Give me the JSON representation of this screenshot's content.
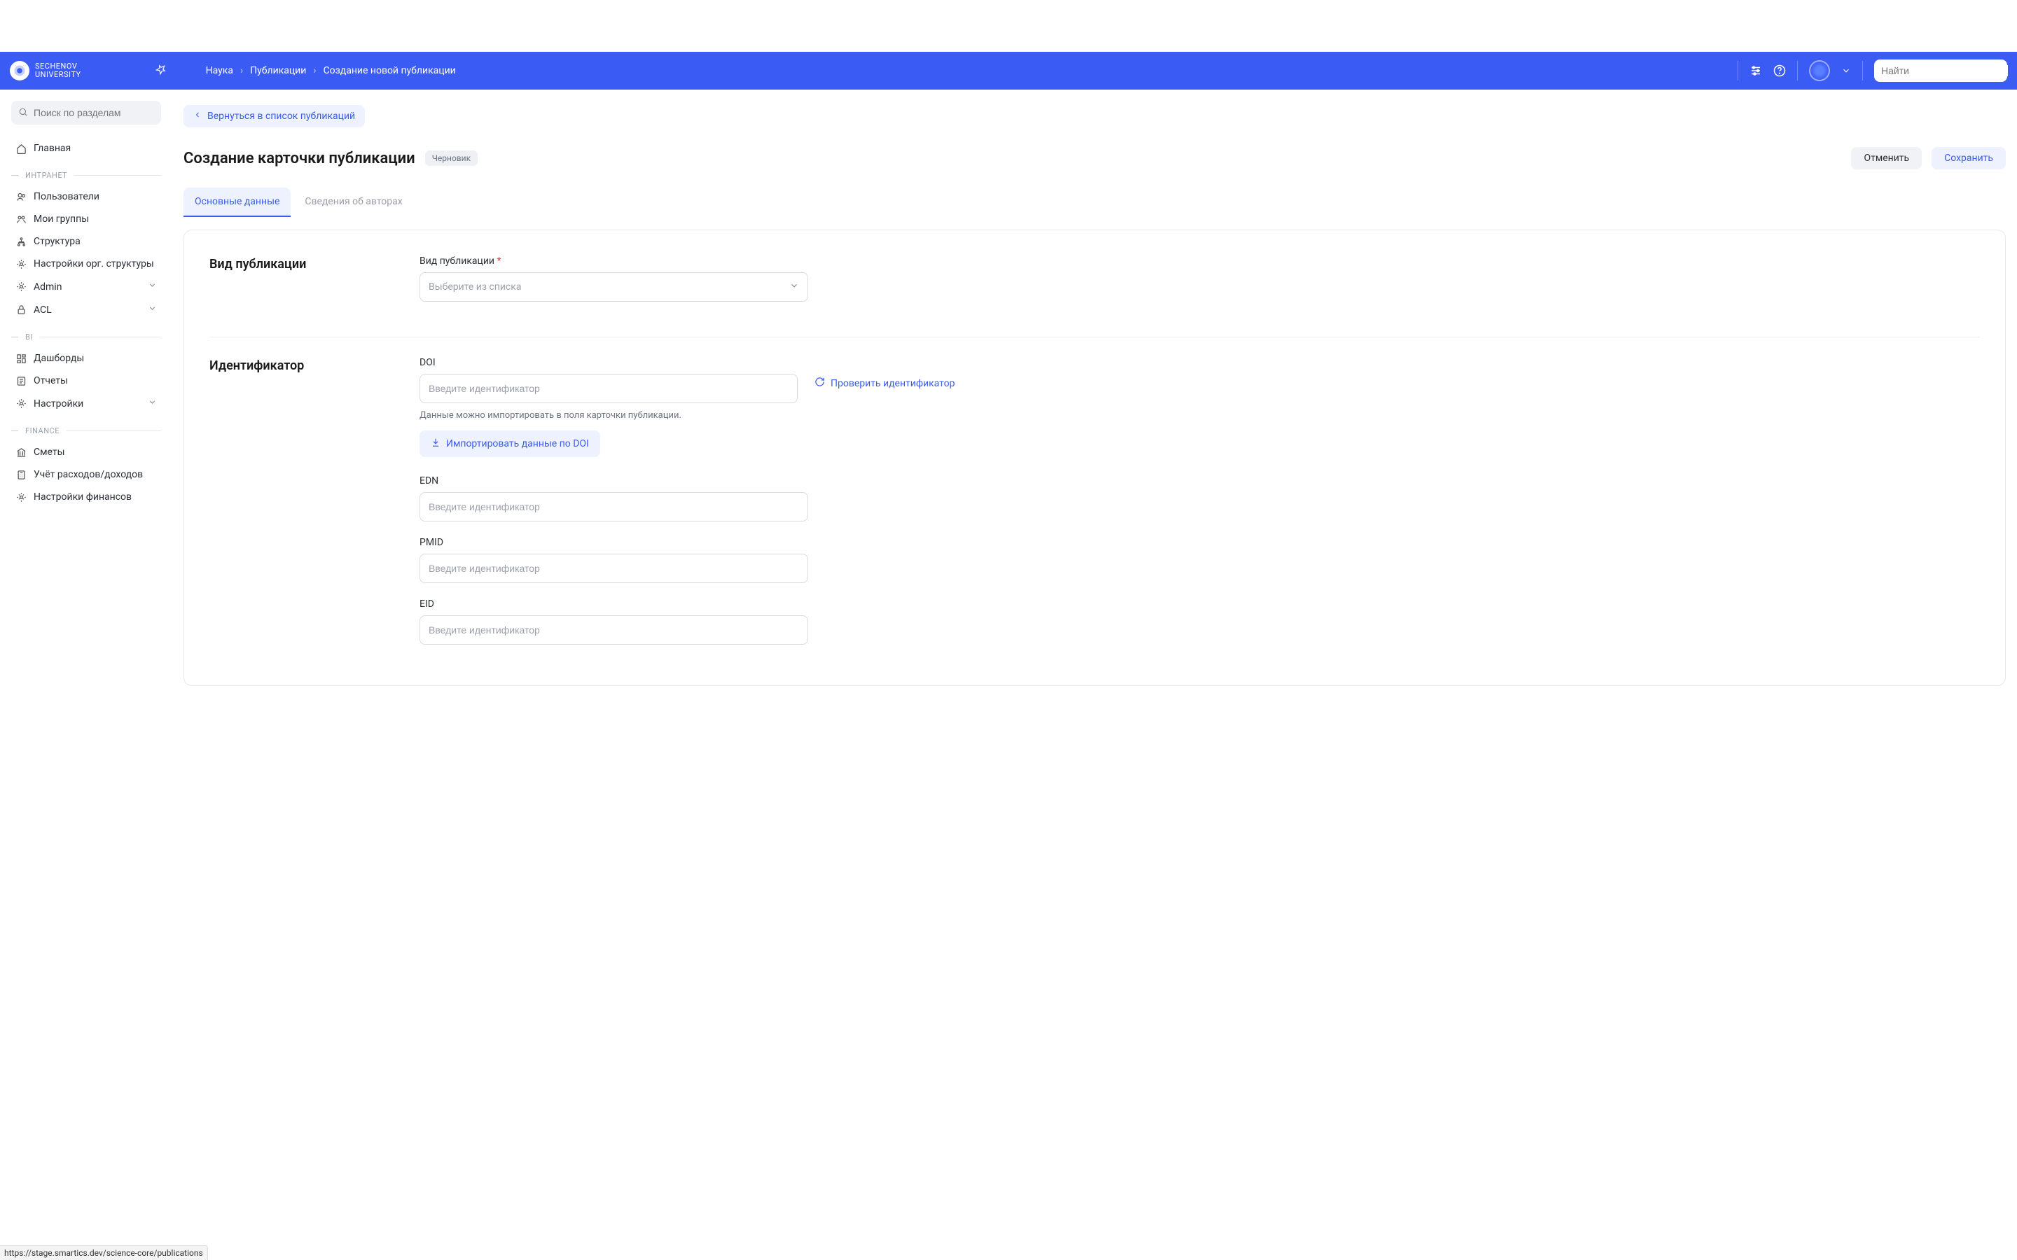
{
  "header": {
    "logo": "SECHENOV\nUNIVERSITY",
    "breadcrumbs": [
      "Наука",
      "Публикации",
      "Создание новой публикации"
    ],
    "search_placeholder": "Найти"
  },
  "sidebar": {
    "search_placeholder": "Поиск по разделам",
    "home": "Главная",
    "sections": [
      {
        "title": "ИНТРАНЕТ",
        "items": [
          {
            "label": "Пользователи",
            "icon": "users"
          },
          {
            "label": "Мои группы",
            "icon": "group"
          },
          {
            "label": "Структура",
            "icon": "sitemap"
          },
          {
            "label": "Настройки орг. структуры",
            "icon": "gear"
          },
          {
            "label": "Admin",
            "icon": "gear",
            "expand": true
          },
          {
            "label": "ACL",
            "icon": "lock",
            "expand": true
          }
        ]
      },
      {
        "title": "BI",
        "items": [
          {
            "label": "Дашборды",
            "icon": "dashboard"
          },
          {
            "label": "Отчеты",
            "icon": "report"
          },
          {
            "label": "Настройки",
            "icon": "gear",
            "expand": true
          }
        ]
      },
      {
        "title": "FINANCE",
        "items": [
          {
            "label": "Сметы",
            "icon": "bank"
          },
          {
            "label": "Учёт расходов/доходов",
            "icon": "calc"
          },
          {
            "label": "Настройки финансов",
            "icon": "gear"
          }
        ]
      }
    ]
  },
  "main": {
    "back": "Вернуться в список публикаций",
    "title": "Создание карточки публикации",
    "badge": "Черновик",
    "cancel": "Отменить",
    "save": "Сохранить",
    "tabs": [
      "Основные данные",
      "Сведения об авторах"
    ],
    "active_tab": 0,
    "section_type": "Вид публикации",
    "type_label": "Вид публикации",
    "type_placeholder": "Выберите из списка",
    "section_id": "Идентификатор",
    "doi_label": "DOI",
    "id_placeholder": "Введите идентификатор",
    "doi_hint": "Данные можно импортировать в поля карточки публикации.",
    "import_btn": "Импортировать данные по DOI",
    "verify": "Проверить идентификатор",
    "edn_label": "EDN",
    "pmid_label": "PMID",
    "eid_label": "EID"
  },
  "status_url": "https://stage.smartics.dev/science-core/publications"
}
